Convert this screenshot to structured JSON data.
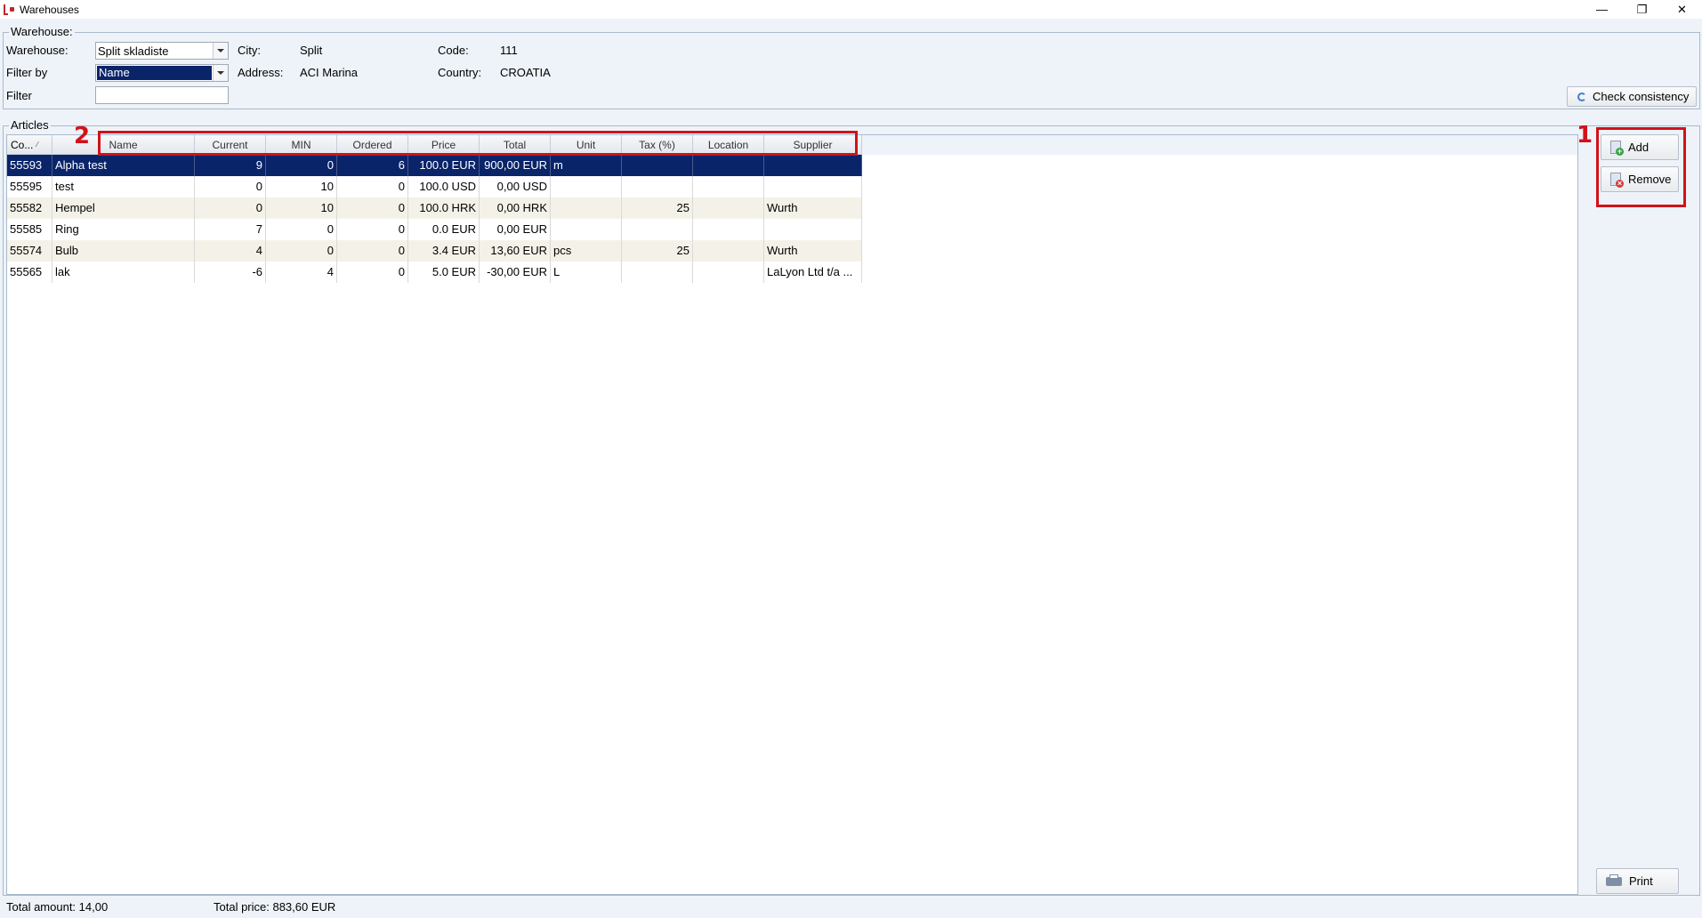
{
  "window": {
    "title": "Warehouses",
    "minimize_glyph": "—",
    "restore_glyph": "❐",
    "close_glyph": "✕"
  },
  "warehouse_group": {
    "legend": "Warehouse:",
    "warehouse_label": "Warehouse:",
    "warehouse_value": "Split skladiste",
    "filter_by_label": "Filter by",
    "filter_by_value": "Name",
    "filter_label": "Filter",
    "filter_value": "",
    "city_label": "City:",
    "city_value": "Split",
    "address_label": "Address:",
    "address_value": "ACI Marina",
    "code_label": "Code:",
    "code_value": "111",
    "country_label": "Country:",
    "country_value": "CROATIA",
    "check_consistency_label": "Check consistency"
  },
  "articles": {
    "legend": "Articles",
    "columns": [
      "Co...",
      "Name",
      "Current",
      "MIN",
      "Ordered",
      "Price",
      "Total",
      "Unit",
      "Tax (%)",
      "Location",
      "Supplier"
    ],
    "rows": [
      [
        "55593",
        "Alpha test",
        "9",
        "0",
        "6",
        "100.0 EUR",
        "900,00 EUR",
        "m",
        "",
        "",
        ""
      ],
      [
        "55595",
        "test",
        "0",
        "10",
        "0",
        "100.0 USD",
        "0,00 USD",
        "",
        "",
        "",
        ""
      ],
      [
        "55582",
        "Hempel",
        "0",
        "10",
        "0",
        "100.0 HRK",
        "0,00 HRK",
        "",
        "25",
        "",
        "Wurth"
      ],
      [
        "55585",
        "Ring",
        "7",
        "0",
        "0",
        "0.0 EUR",
        "0,00 EUR",
        "",
        "",
        "",
        ""
      ],
      [
        "55574",
        "Bulb",
        "4",
        "0",
        "0",
        "3.4 EUR",
        "13,60 EUR",
        "pcs",
        "25",
        "",
        "Wurth"
      ],
      [
        "55565",
        "lak",
        "-6",
        "4",
        "0",
        "5.0 EUR",
        "-30,00 EUR",
        "L",
        "",
        "",
        "LaLyon Ltd t/a ..."
      ]
    ],
    "selected_row": 0
  },
  "actions": {
    "add_label": "Add",
    "remove_label": "Remove",
    "print_label": "Print"
  },
  "annotations": {
    "callout_1": "1",
    "callout_2": "2",
    "color": "#d1121a"
  },
  "status": {
    "total_amount": "Total amount: 14,00",
    "total_price": "Total price: 883,60 EUR"
  },
  "colors": {
    "selection": "#0a246a",
    "background": "#eef3f9"
  }
}
